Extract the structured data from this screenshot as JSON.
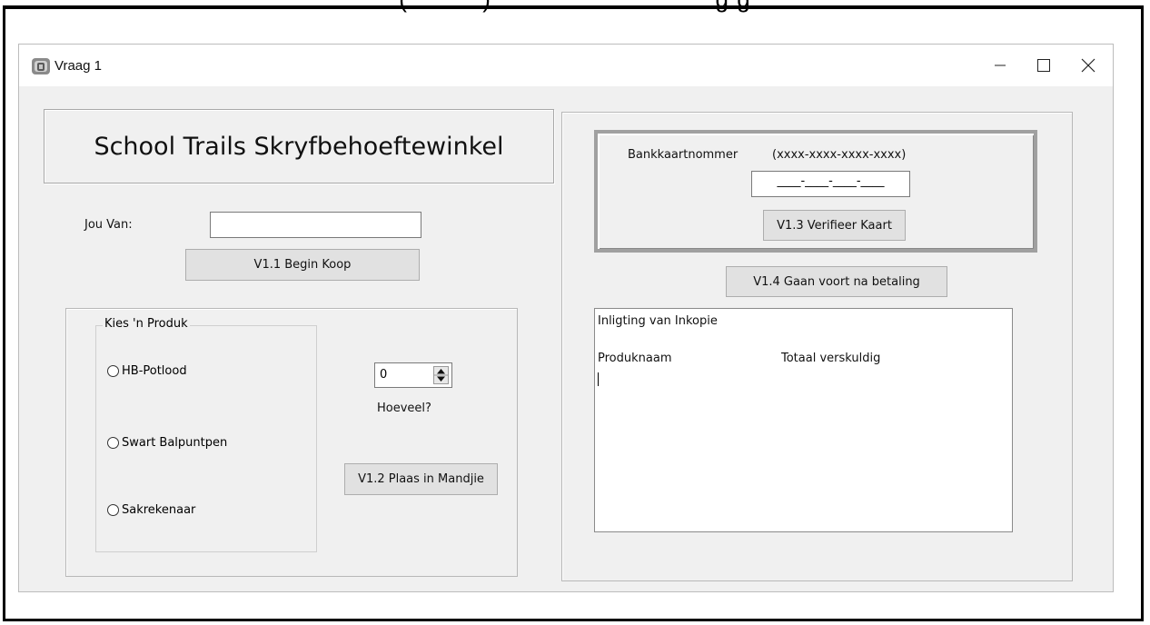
{
  "document": {
    "heading_fragment": "(          )                              g g"
  },
  "window": {
    "title": "Vraag 1",
    "icon": "app-icon",
    "controls": {
      "minimize": "—",
      "maximize": "☐",
      "close": "✕"
    }
  },
  "left": {
    "shop_title": "School Trails Skryfbehoeftewinkel",
    "name_label": "Jou Van:",
    "name_value": "",
    "begin_button": "V1.1  Begin Koop",
    "product_group_label": "Kies 'n Produk",
    "products": [
      {
        "label": "HB-Potlood",
        "selected": false
      },
      {
        "label": "Swart Balpuntpen",
        "selected": false
      },
      {
        "label": "Sakrekenaar",
        "selected": false
      }
    ],
    "quantity_value": "0",
    "quantity_label": "Hoeveel?",
    "add_button": "V1.2 Plaas in Mandjie"
  },
  "right": {
    "card_label": "Bankkaartnommer",
    "card_format": "(xxxx-xxxx-xxxx-xxxx)",
    "card_mask": "____-____-____-____",
    "verify_button": "V1.3  Verifieer Kaart",
    "continue_button": "V1.4 Gaan voort na betaling",
    "memo_heading": "Inligting van Inkopie",
    "memo_col1": "Produknaam",
    "memo_col2": "Totaal verskuldig"
  },
  "colors": {
    "window_bg": "#f0f0f0",
    "button_bg": "#e1e1e1",
    "border": "#adadad"
  }
}
